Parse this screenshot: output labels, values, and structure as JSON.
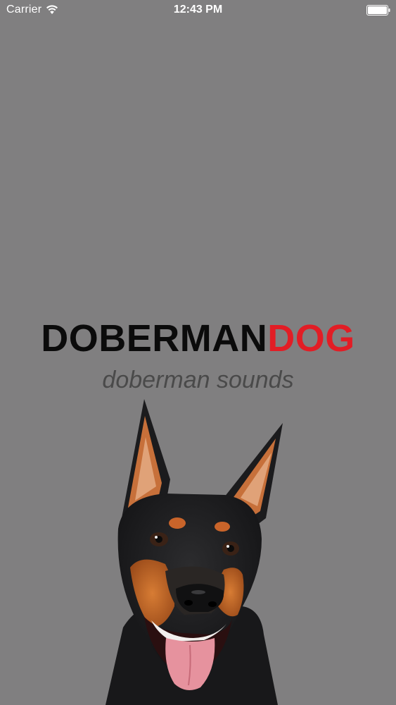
{
  "status_bar": {
    "carrier": "Carrier",
    "time": "12:43 PM",
    "icons": [
      "wifi-icon",
      "battery-icon"
    ]
  },
  "splash": {
    "title_part_1": "DOBERMAN",
    "title_part_2": "DOG",
    "subtitle": "doberman sounds",
    "image": "doberman-dog-photo"
  },
  "colors": {
    "background": "#807f80",
    "title_dark": "#0b0b0b",
    "title_accent": "#e21d25",
    "subtitle": "#4a4a4a",
    "status_text": "#ffffff"
  }
}
